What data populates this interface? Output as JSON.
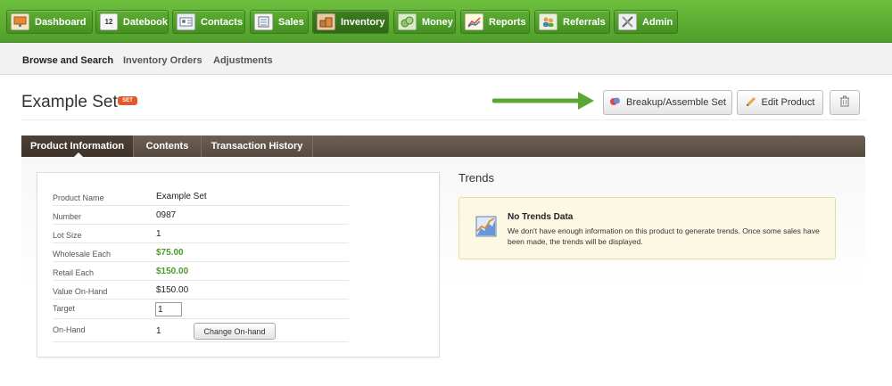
{
  "nav": {
    "items": [
      {
        "label": "Dashboard",
        "icon": "dashboard-icon",
        "active": false
      },
      {
        "label": "Datebook",
        "icon": "calendar-icon",
        "icon_text": "12",
        "active": false
      },
      {
        "label": "Contacts",
        "icon": "address-card-icon",
        "active": false
      },
      {
        "label": "Sales",
        "icon": "register-icon",
        "active": false
      },
      {
        "label": "Inventory",
        "icon": "boxes-icon",
        "active": true
      },
      {
        "label": "Money",
        "icon": "money-icon",
        "active": false
      },
      {
        "label": "Reports",
        "icon": "chart-icon",
        "active": false
      },
      {
        "label": "Referrals",
        "icon": "people-icon",
        "active": false
      },
      {
        "label": "Admin",
        "icon": "tools-icon",
        "active": false
      }
    ]
  },
  "subnav": {
    "items": [
      {
        "label": "Browse and Search",
        "active": true
      },
      {
        "label": "Inventory Orders",
        "active": false
      },
      {
        "label": "Adjustments",
        "active": false
      }
    ]
  },
  "header": {
    "title": "Example Set",
    "badge": "SET",
    "breakup_label": "Breakup/Assemble Set",
    "edit_label": "Edit Product",
    "delete_icon": "trash-icon"
  },
  "tabs": [
    {
      "label": "Product Information",
      "active": true
    },
    {
      "label": "Contents",
      "active": false
    },
    {
      "label": "Transaction History",
      "active": false
    }
  ],
  "product": {
    "name_label": "Product Name",
    "name": "Example Set",
    "number_label": "Number",
    "number": "0987",
    "lot_size_label": "Lot Size",
    "lot_size": "1",
    "wholesale_label": "Wholesale Each",
    "wholesale": "$75.00",
    "retail_label": "Retail Each",
    "retail": "$150.00",
    "value_label": "Value On-Hand",
    "value": "$150.00",
    "target_label": "Target",
    "target": "1",
    "onhand_label": "On-Hand",
    "onhand": "1",
    "change_label": "Change On-hand"
  },
  "trends": {
    "title": "Trends",
    "heading": "No Trends Data",
    "message": "We don't have enough information on this product to generate trends. Once some sales have been made, the trends will be displayed."
  },
  "colors": {
    "nav_green": "#5daf33",
    "tab_brown": "#5f5248",
    "price_green": "#4a9a2a",
    "badge_orange": "#e05a2b",
    "notice_bg": "#fdf8e4",
    "arrow_green": "#5aa832"
  }
}
